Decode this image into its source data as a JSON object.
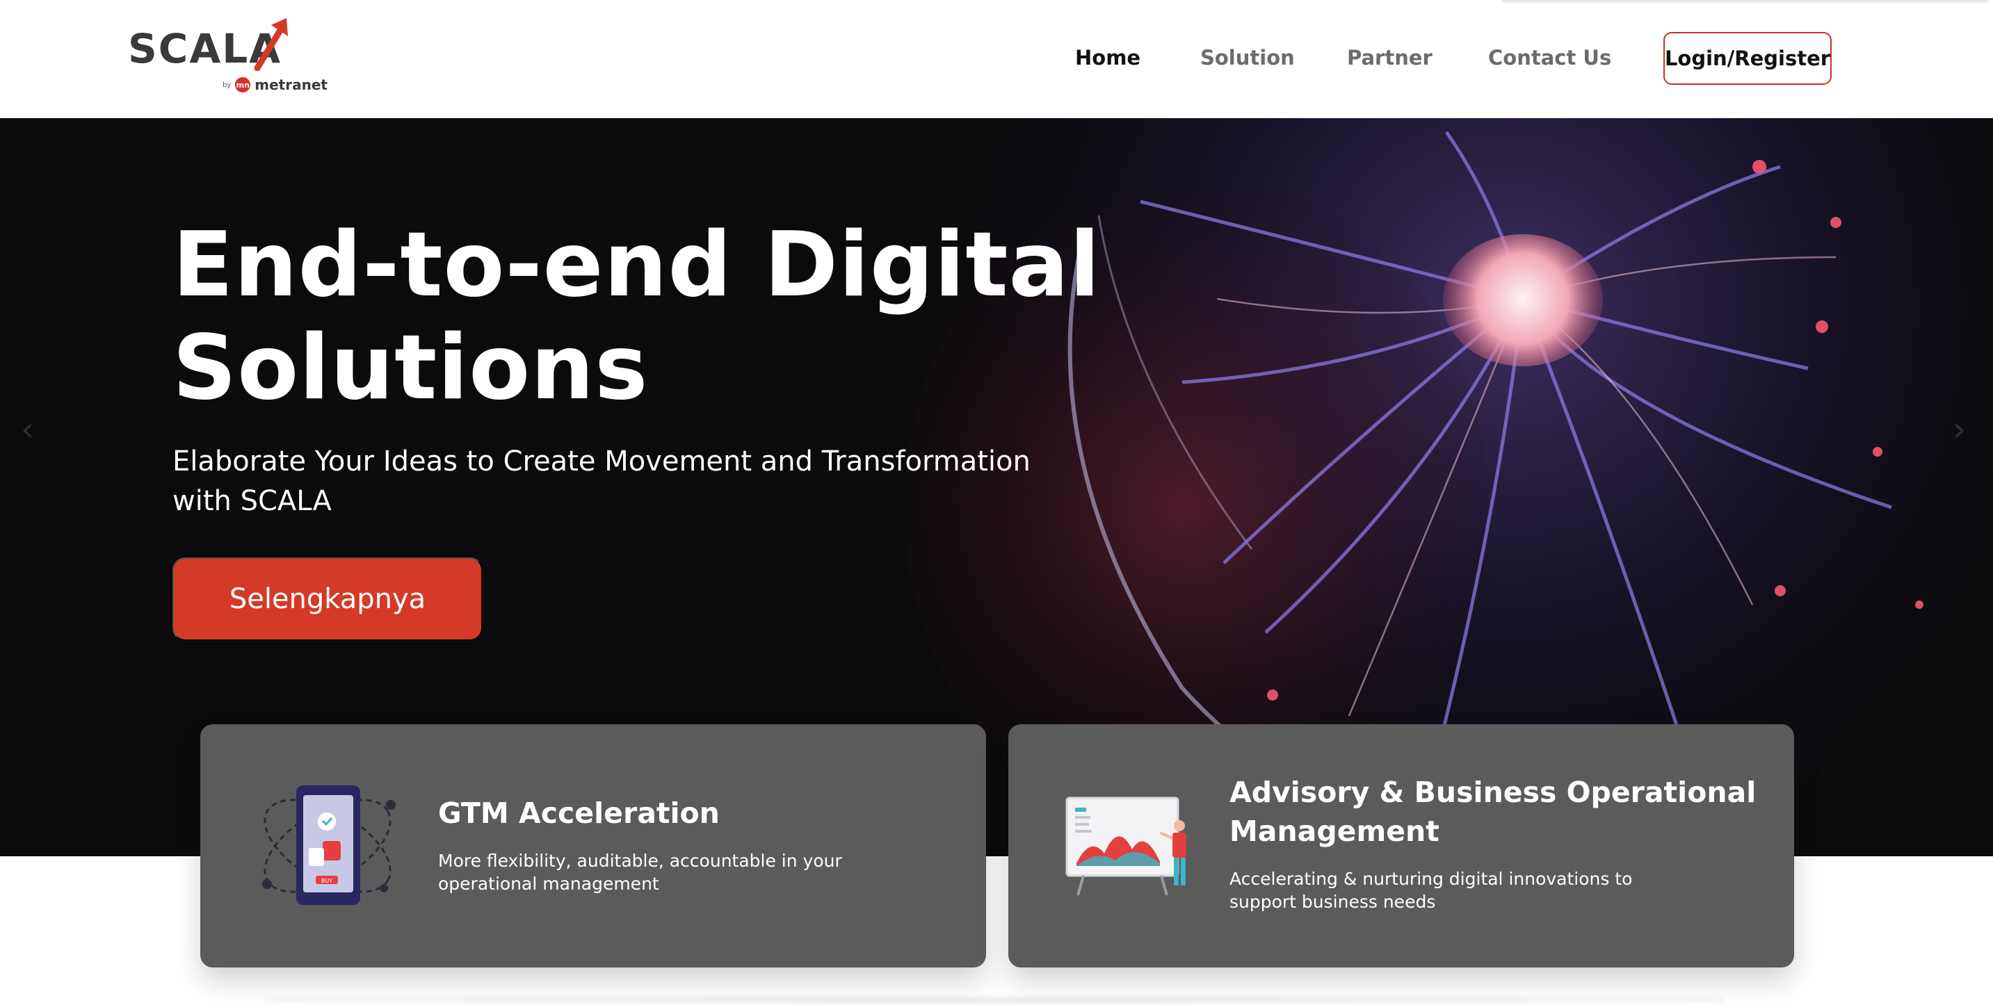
{
  "brand": {
    "name": "SCALA",
    "by_label": "by",
    "partner_name": "metranet",
    "partner_icon": "mn",
    "accent_color": "#d53a26"
  },
  "nav": {
    "items": [
      {
        "label": "Home",
        "active": true
      },
      {
        "label": "Solution",
        "active": false
      },
      {
        "label": "Partner",
        "active": false
      },
      {
        "label": "Contact Us",
        "active": false
      }
    ],
    "login_label": "Login/Register"
  },
  "hero": {
    "title_line1": "End-to-end Digital",
    "title_line2": "Solutions",
    "subtitle": "Elaborate Your Ideas to Create Movement and Transformation with SCALA",
    "cta_label": "Selengkapnya",
    "prev_icon": "chevron-left-icon",
    "next_icon": "chevron-right-icon"
  },
  "cards": [
    {
      "icon": "mobile-commerce-illustration",
      "title": "GTM Acceleration",
      "description": "More flexibility, auditable, accountable in your operational management",
      "badge": "BUY"
    },
    {
      "icon": "presentation-board-illustration",
      "title": "Advisory & Business Operational Management",
      "description": "Accelerating & nurturing digital innovations to support business needs"
    }
  ]
}
